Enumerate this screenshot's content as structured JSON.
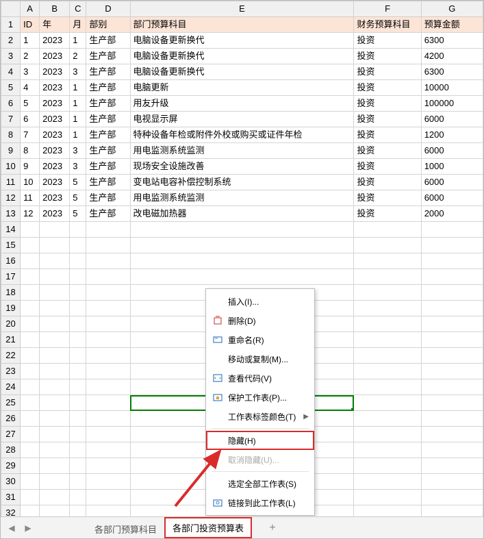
{
  "columns": [
    "A",
    "B",
    "C",
    "D",
    "E",
    "F",
    "G"
  ],
  "row_headers": [
    1,
    2,
    3,
    4,
    5,
    6,
    7,
    8,
    9,
    10,
    11,
    12,
    13,
    14,
    15,
    16,
    17,
    18,
    19,
    20,
    21,
    22,
    23,
    24,
    25,
    26,
    27,
    28,
    29,
    30,
    31,
    32
  ],
  "header_row": {
    "A": "ID",
    "B": "年",
    "C": "月",
    "D": "部别",
    "E": "部门预算科目",
    "F": "财务预算科目",
    "G": "预算金额"
  },
  "rows": [
    {
      "A": "1",
      "B": "2023",
      "C": "1",
      "D": "生产部",
      "E": "电脑设备更新换代",
      "F": "投资",
      "G": "6300"
    },
    {
      "A": "2",
      "B": "2023",
      "C": "2",
      "D": "生产部",
      "E": "电脑设备更新换代",
      "F": "投资",
      "G": "4200"
    },
    {
      "A": "3",
      "B": "2023",
      "C": "3",
      "D": "生产部",
      "E": "电脑设备更新换代",
      "F": "投资",
      "G": "6300"
    },
    {
      "A": "4",
      "B": "2023",
      "C": "1",
      "D": "生产部",
      "E": "电脑更新",
      "F": "投资",
      "G": "10000"
    },
    {
      "A": "5",
      "B": "2023",
      "C": "1",
      "D": "生产部",
      "E": "用友升级",
      "F": "投资",
      "G": "100000"
    },
    {
      "A": "6",
      "B": "2023",
      "C": "1",
      "D": "生产部",
      "E": "电视显示屏",
      "F": "投资",
      "G": "6000"
    },
    {
      "A": "7",
      "B": "2023",
      "C": "1",
      "D": "生产部",
      "E": "特种设备年检或附件外校或购买或证件年检",
      "F": "投资",
      "G": "1200"
    },
    {
      "A": "8",
      "B": "2023",
      "C": "3",
      "D": "生产部",
      "E": "用电监测系统监测",
      "F": "投资",
      "G": "6000"
    },
    {
      "A": "9",
      "B": "2023",
      "C": "3",
      "D": "生产部",
      "E": "现场安全设施改善",
      "F": "投资",
      "G": "1000"
    },
    {
      "A": "10",
      "B": "2023",
      "C": "5",
      "D": "生产部",
      "E": "变电站电容补偿控制系统",
      "F": "投资",
      "G": "6000"
    },
    {
      "A": "11",
      "B": "2023",
      "C": "5",
      "D": "生产部",
      "E": "用电监测系统监测",
      "F": "投资",
      "G": "6000"
    },
    {
      "A": "12",
      "B": "2023",
      "C": "5",
      "D": "生产部",
      "E": "改电磁加热器",
      "F": "投资",
      "G": "2000"
    }
  ],
  "selected_cell": {
    "row": 25,
    "col": "E"
  },
  "sheet_tabs": {
    "items": [
      {
        "label": "各部门预算科目",
        "active": false
      },
      {
        "label": "各部门投资预算表",
        "active": true
      }
    ]
  },
  "context_menu": {
    "items": [
      {
        "label": "插入(I)...",
        "icon": "",
        "has_sub": false
      },
      {
        "label": "删除(D)",
        "icon": "delete",
        "has_sub": false
      },
      {
        "label": "重命名(R)",
        "icon": "rename",
        "has_sub": false
      },
      {
        "label": "移动或复制(M)...",
        "icon": "",
        "has_sub": false
      },
      {
        "label": "查看代码(V)",
        "icon": "code",
        "has_sub": false
      },
      {
        "label": "保护工作表(P)...",
        "icon": "protect",
        "has_sub": false
      },
      {
        "label": "工作表标签颜色(T)",
        "icon": "",
        "has_sub": true
      },
      {
        "label": "隐藏(H)",
        "icon": "",
        "has_sub": false,
        "highlight": true
      },
      {
        "label": "取消隐藏(U)...",
        "icon": "",
        "has_sub": false,
        "disabled": true
      },
      {
        "label": "选定全部工作表(S)",
        "icon": "",
        "has_sub": false
      },
      {
        "label": "链接到此工作表(L)",
        "icon": "link",
        "has_sub": false
      }
    ]
  },
  "chart_data": {
    "type": "table",
    "title": "各部门投资预算表",
    "columns": [
      "ID",
      "年",
      "月",
      "部别",
      "部门预算科目",
      "财务预算科目",
      "预算金额"
    ],
    "rows": [
      [
        1,
        2023,
        1,
        "生产部",
        "电脑设备更新换代",
        "投资",
        6300
      ],
      [
        2,
        2023,
        2,
        "生产部",
        "电脑设备更新换代",
        "投资",
        4200
      ],
      [
        3,
        2023,
        3,
        "生产部",
        "电脑设备更新换代",
        "投资",
        6300
      ],
      [
        4,
        2023,
        1,
        "生产部",
        "电脑更新",
        "投资",
        10000
      ],
      [
        5,
        2023,
        1,
        "生产部",
        "用友升级",
        "投资",
        100000
      ],
      [
        6,
        2023,
        1,
        "生产部",
        "电视显示屏",
        "投资",
        6000
      ],
      [
        7,
        2023,
        1,
        "生产部",
        "特种设备年检或附件外校或购买或证件年检",
        "投资",
        1200
      ],
      [
        8,
        2023,
        3,
        "生产部",
        "用电监测系统监测",
        "投资",
        6000
      ],
      [
        9,
        2023,
        3,
        "生产部",
        "现场安全设施改善",
        "投资",
        1000
      ],
      [
        10,
        2023,
        5,
        "生产部",
        "变电站电容补偿控制系统",
        "投资",
        6000
      ],
      [
        11,
        2023,
        5,
        "生产部",
        "用电监测系统监测",
        "投资",
        6000
      ],
      [
        12,
        2023,
        5,
        "生产部",
        "改电磁加热器",
        "投资",
        2000
      ]
    ]
  }
}
